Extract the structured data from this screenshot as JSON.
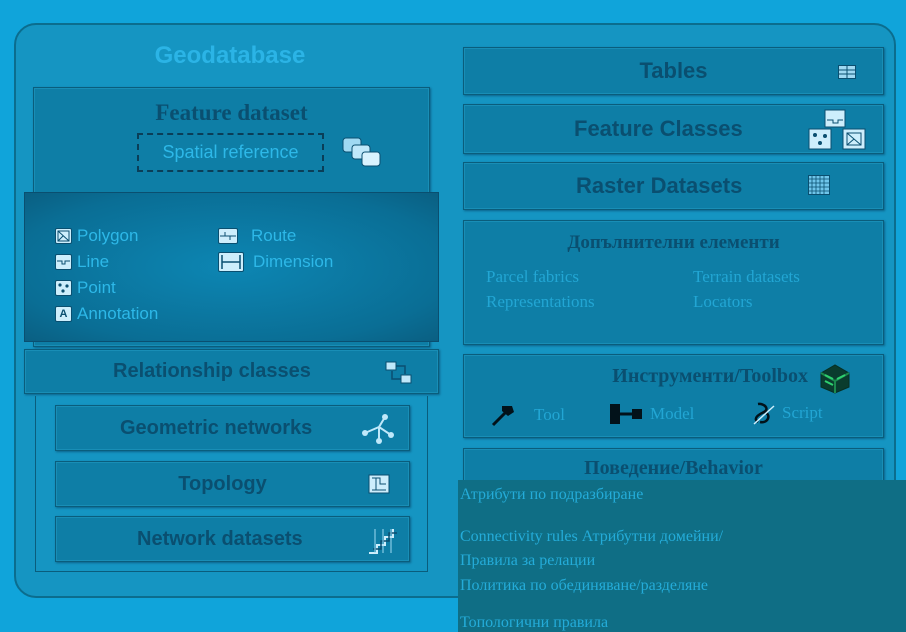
{
  "geodatabase": {
    "title": "Geodatabase",
    "feature_dataset": {
      "title": "Feature dataset",
      "spatial_reference": "Spatial reference"
    },
    "feature_types": {
      "left": [
        "Polygon",
        "Line",
        "Point",
        "Annotation"
      ],
      "right": [
        "Route",
        "Dimension"
      ]
    },
    "relationship_classes": "Relationship classes",
    "geometric_networks": "Geometric networks",
    "topology": "Topology",
    "network_datasets": "Network datasets"
  },
  "right": {
    "tables": "Tables",
    "feature_classes": "Feature Classes",
    "raster_datasets": "Raster Datasets",
    "additional": {
      "title": "Допълнителни елементи",
      "items": [
        "Parcel fabrics",
        "Terrain datasets",
        "Representations",
        "Locators"
      ]
    },
    "tools": {
      "title": "Инструменти/Toolbox",
      "tool": "Tool",
      "model": "Model",
      "script": "Script"
    },
    "behavior": {
      "title": "Поведение/Behavior",
      "line1": "Атрибути по подразбиране",
      "line2": "Connectivity rules Атрибутни домейни/",
      "line3": "Правила за релации",
      "line4": "Политика по обединяване/разделяне",
      "line5": "Топологични правила"
    }
  },
  "colors": {
    "background": "#10a4da",
    "panel": "#0e7ea6",
    "title_dark": "#0a4f70",
    "text_light": "#2db8e8"
  },
  "icons": [
    "table-icon",
    "feature-classes-icon",
    "raster-icon",
    "spatial-reference-icon",
    "polygon-icon",
    "line-icon",
    "point-icon",
    "annotation-icon",
    "route-icon",
    "dimension-icon",
    "relationship-icon",
    "network-icon",
    "topology-icon",
    "network-dataset-icon",
    "toolbox-icon",
    "hammer-icon",
    "model-icon",
    "script-icon"
  ]
}
